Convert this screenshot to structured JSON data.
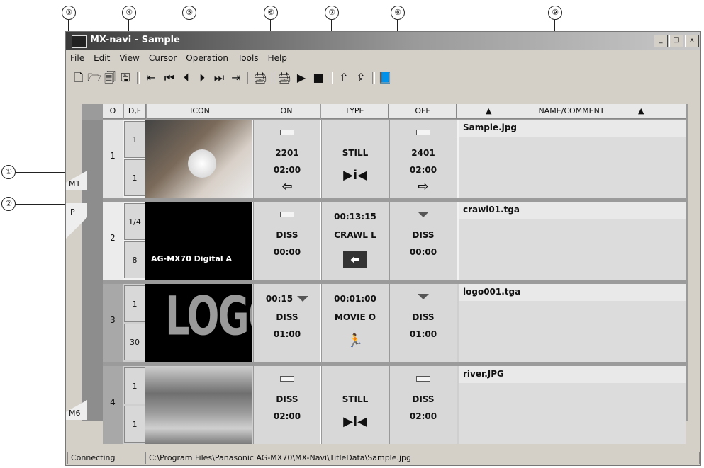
{
  "callouts": [
    "①",
    "②",
    "③",
    "④",
    "⑤",
    "⑥",
    "⑦",
    "⑧",
    "⑨"
  ],
  "window": {
    "title": "MX-navi - Sample",
    "controls": [
      "_",
      "□",
      "x"
    ]
  },
  "menu": [
    "File",
    "Edit",
    "View",
    "Cursor",
    "Operation",
    "Tools",
    "Help"
  ],
  "toolbar_icons": [
    "new-icon",
    "open-icon",
    "save-as-icon",
    "save-icon",
    "go-start-icon",
    "first-icon",
    "prev-icon",
    "next-icon",
    "last-icon",
    "go-end-icon",
    "send-icon",
    "send-all-icon",
    "play-icon",
    "stop-icon",
    "upload-icon",
    "upload-all-icon",
    "book-icon"
  ],
  "columns": [
    "O",
    "D,F",
    "ICON",
    "ON",
    "TYPE",
    "OFF",
    "NAME/COMMENT"
  ],
  "rows": [
    {
      "num": "1",
      "d": "1",
      "f": "1",
      "icon": "photo-dog",
      "on": {
        "top": "",
        "indicator": "bar",
        "mid": "2201",
        "bot": "02:00",
        "sym": "⇦"
      },
      "type": {
        "top": "",
        "mid": "STILL",
        "sym": "▶i◀"
      },
      "off": {
        "indicator": "bar",
        "mid": "2401",
        "bot": "02:00",
        "sym": "⇨"
      },
      "name": "Sample.jpg",
      "tab": "M1"
    },
    {
      "num": "2",
      "d": "1/4",
      "f": "8",
      "icon": "black-title",
      "icon_text": "AG-MX70  Digital A",
      "on": {
        "top": "",
        "indicator": "bar",
        "mid": "DISS",
        "bot": "00:00",
        "sym": ""
      },
      "type": {
        "top": "00:13:15",
        "mid": "CRAWL L",
        "sym": "⬅"
      },
      "off": {
        "indicator": "tri",
        "mid": "DISS",
        "bot": "00:00",
        "sym": ""
      },
      "name": "crawl01.tga",
      "tab": "P"
    },
    {
      "num": "3",
      "d": "1",
      "f": "30",
      "icon": "logo",
      "icon_text": "LOGO",
      "on": {
        "top": "00:15",
        "indicator": "tri",
        "mid": "DISS",
        "bot": "01:00",
        "sym": ""
      },
      "type": {
        "top": "00:01:00",
        "mid": "MOVIE O",
        "sym": "🏃"
      },
      "off": {
        "indicator": "tri",
        "mid": "DISS",
        "bot": "01:00",
        "sym": ""
      },
      "name": "logo001.tga",
      "tab": ""
    },
    {
      "num": "4",
      "d": "1",
      "f": "1",
      "icon": "photo-river",
      "on": {
        "top": "",
        "indicator": "bar",
        "mid": "DISS",
        "bot": "02:00",
        "sym": ""
      },
      "type": {
        "top": "",
        "mid": "STILL",
        "sym": "▶i◀"
      },
      "off": {
        "indicator": "bar",
        "mid": "DISS",
        "bot": "02:00",
        "sym": ""
      },
      "name": "river.JPG",
      "tab": "M6"
    }
  ],
  "status": {
    "state": "Connecting",
    "path": "C:\\Program Files\\Panasonic AG-MX70\\MX-Navi\\TitleData\\Sample.jpg"
  }
}
